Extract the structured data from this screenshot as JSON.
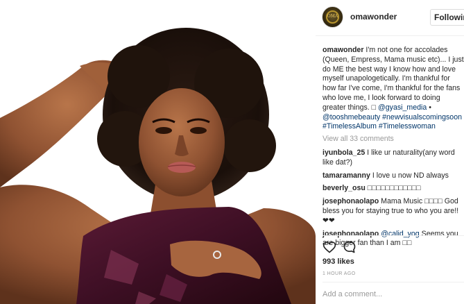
{
  "post": {
    "username": "omawonder",
    "follow_label": "Following",
    "avatar_text": "OMA",
    "caption": {
      "username": "omawonder",
      "text": " I'm not one for accolades (Queen, Empress, Mama music etc)... I just do ME the best way I know how and love myself unapologetically. I'm thankful for how far I've come, I'm thankful for the fans who love me, I look forward to doing greater things. ",
      "glyph": "□ ",
      "mention1": "@gyasi_media",
      "dot": " •",
      "mention2": "@tooshmebeauty",
      "hashtag1": " #newvisualscomingsoon",
      "hashtag2": "#TimelessAlbum",
      "hashtag3": " #Timelesswoman"
    },
    "view_all": "View all 33 comments",
    "comments": [
      {
        "user": "iyunbola_25",
        "text": " I like ur naturality(any word like dat?)"
      },
      {
        "user": "tamaramanny",
        "text": " I love u now ND always"
      },
      {
        "user": "beverly_osu",
        "text": " □□□□□□□□□□□□"
      },
      {
        "user": "josephonaolapo",
        "text": " Mama Music □□□□ God bless you for staying true to who you are!! ❤❤"
      },
      {
        "user": "josephonaolapo",
        "mention": " @calid_yog",
        "text": " Seems you are bigger fan than I am □□"
      }
    ],
    "likes": "993 likes",
    "time": "1 HOUR AGO",
    "add_comment_placeholder": "Add a comment...",
    "icons": {
      "like": "heart-outline-icon",
      "comment": "speech-bubble-icon"
    }
  }
}
